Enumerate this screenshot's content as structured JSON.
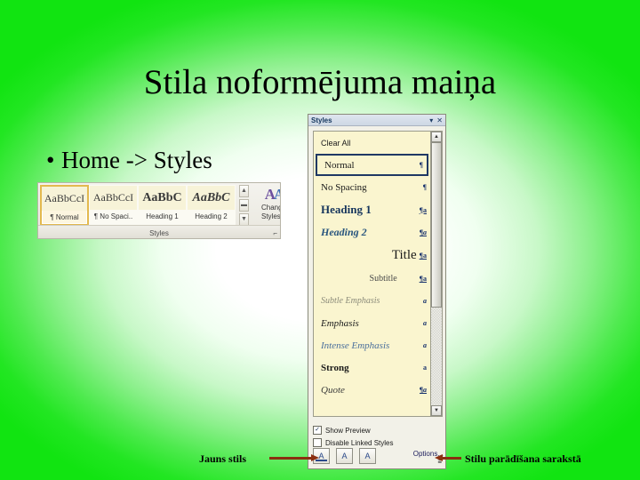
{
  "slide": {
    "title": "Stila noformējuma maiņa",
    "bullet": "Home -> Styles",
    "bullet_marker": "•",
    "background_edge_color": "#11e411",
    "background_center_color": "#ffffff"
  },
  "ribbon": {
    "group_name": "Styles",
    "dialog_launcher": "⌐",
    "gallery": [
      {
        "preview": "AaBbCcI",
        "name": "¶ Normal",
        "selected": true,
        "style": "n"
      },
      {
        "preview": "AaBbCcI",
        "name": "¶ No Spaci..",
        "selected": false,
        "style": "n"
      },
      {
        "preview": "AaBbC",
        "name": "Heading 1",
        "selected": false,
        "style": "b"
      },
      {
        "preview": "AaBbC",
        "name": "Heading 2",
        "selected": false,
        "style": "i"
      }
    ],
    "spinner": {
      "up": "▲",
      "mid": "▬",
      "down": "▼"
    },
    "change_styles": {
      "glyph_a": "A",
      "glyph_b": "A",
      "line1": "Change",
      "line2": "Styles ▾"
    }
  },
  "pane": {
    "title": "Styles",
    "minimize_icon": "▾",
    "close_icon": "✕",
    "styles": [
      {
        "label": "Clear All",
        "mark": "",
        "cls": "row-clear"
      },
      {
        "label": "Normal",
        "mark": "¶",
        "cls": "row-normal"
      },
      {
        "label": "No Spacing",
        "mark": "¶",
        "cls": "row-nospacing"
      },
      {
        "label": "Heading 1",
        "mark": "¶a",
        "cls": "row-h1"
      },
      {
        "label": "Heading 2",
        "mark": "¶a",
        "cls": "row-h2"
      },
      {
        "label": "Title",
        "mark": "¶a",
        "cls": "row-title"
      },
      {
        "label": "Subtitle",
        "mark": "¶a",
        "cls": "row-subtitle"
      },
      {
        "label": "Subtle Emphasis",
        "mark": "a",
        "cls": "row-subem"
      },
      {
        "label": "Emphasis",
        "mark": "a",
        "cls": "row-em"
      },
      {
        "label": "Intense Emphasis",
        "mark": "a",
        "cls": "row-intem"
      },
      {
        "label": "Strong",
        "mark": "a",
        "cls": "row-strong"
      },
      {
        "label": "Quote",
        "mark": "¶a",
        "cls": "row-quote"
      }
    ],
    "scrollbar": {
      "up": "▲",
      "down": "▼",
      "thumb_percent": 63
    },
    "checkboxes": [
      {
        "label": "Show Preview",
        "checked": true,
        "glyph": "✓"
      },
      {
        "label": "Disable Linked Styles",
        "checked": false,
        "glyph": ""
      }
    ],
    "buttons": [
      {
        "name": "new-style",
        "glyph": "A"
      },
      {
        "name": "style-inspector",
        "glyph": "A"
      },
      {
        "name": "manage-styles",
        "glyph": "A"
      }
    ],
    "options_link": "Options...",
    "resize_caret": "≡"
  },
  "annotations": {
    "left_label": "Jauns stils",
    "right_label": "Stilu parādīšana sarakstā",
    "arrow_color": "#8b2f10"
  }
}
